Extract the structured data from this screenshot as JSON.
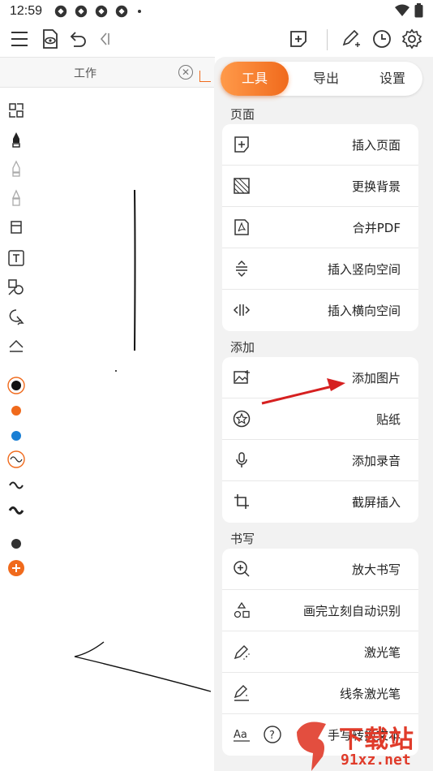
{
  "status_bar": {
    "time": "12:59"
  },
  "tab": {
    "title": "工作"
  },
  "panel": {
    "tabs": [
      {
        "label": "工具",
        "active": true
      },
      {
        "label": "导出",
        "active": false
      },
      {
        "label": "设置",
        "active": false
      }
    ],
    "sections": [
      {
        "title": "页面",
        "items": [
          {
            "label": "插入页面",
            "icon": "add-page-icon"
          },
          {
            "label": "更换背景",
            "icon": "background-icon"
          },
          {
            "label": "合并PDF",
            "icon": "pdf-icon"
          },
          {
            "label": "插入竖向空间",
            "icon": "vertical-space-icon"
          },
          {
            "label": "插入横向空间",
            "icon": "horizontal-space-icon"
          }
        ]
      },
      {
        "title": "添加",
        "items": [
          {
            "label": "添加图片",
            "icon": "image-icon"
          },
          {
            "label": "贴纸",
            "icon": "sticker-icon"
          },
          {
            "label": "添加录音",
            "icon": "microphone-icon"
          },
          {
            "label": "截屏插入",
            "icon": "crop-icon"
          }
        ]
      },
      {
        "title": "书写",
        "items": [
          {
            "label": "放大书写",
            "icon": "zoom-write-icon"
          },
          {
            "label": "画完立刻自动识别",
            "icon": "shape-recognize-icon"
          },
          {
            "label": "激光笔",
            "icon": "laser-pen-icon"
          },
          {
            "label": "线条激光笔",
            "icon": "line-laser-icon"
          },
          {
            "label": "手写转换文本",
            "icon": "text-convert-icon",
            "extra_icon": "help-icon"
          }
        ]
      }
    ]
  },
  "watermark": {
    "line1": "下载站",
    "line2": "91xz.net"
  },
  "colors": {
    "accent": "#f06a1c",
    "annotation": "#d62020",
    "blue": "#1a7fd4"
  }
}
